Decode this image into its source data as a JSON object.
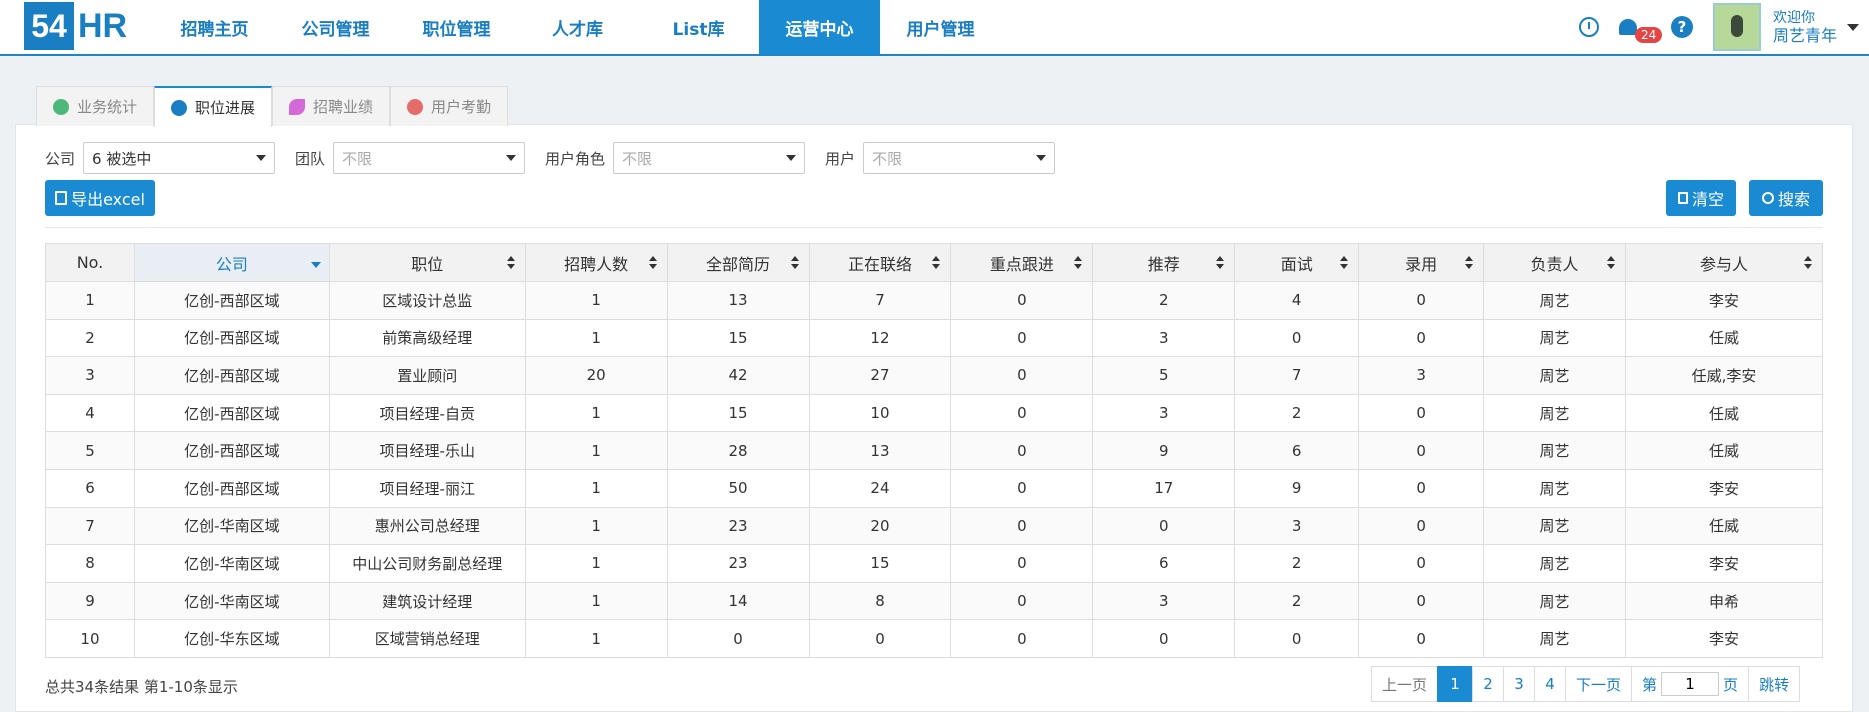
{
  "header": {
    "logo_number": "54",
    "logo_text": "HR",
    "nav": [
      {
        "label": "招聘主页"
      },
      {
        "label": "公司管理"
      },
      {
        "label": "职位管理"
      },
      {
        "label": "人才库"
      },
      {
        "label": "List库"
      },
      {
        "label": "运营中心",
        "active": true
      },
      {
        "label": "用户管理"
      }
    ],
    "notification_count": "24",
    "welcome": "欢迎你",
    "user_name": "周艺青年"
  },
  "tabs": [
    {
      "label": "业务统计",
      "icon": "user-icon"
    },
    {
      "label": "职位进展",
      "icon": "users-icon",
      "active": true
    },
    {
      "label": "招聘业绩",
      "icon": "leaf-icon"
    },
    {
      "label": "用户考勤",
      "icon": "attendance-icon"
    }
  ],
  "filters": {
    "company_label": "公司",
    "company_value": "6 被选中",
    "team_label": "团队",
    "team_placeholder": "不限",
    "role_label": "用户角色",
    "role_placeholder": "不限",
    "user_label": "用户",
    "user_placeholder": "不限"
  },
  "buttons": {
    "export": "导出excel",
    "clear": "清空",
    "search": "搜索"
  },
  "table": {
    "columns": [
      "No.",
      "公司",
      "职位",
      "招聘人数",
      "全部简历",
      "正在联络",
      "重点跟进",
      "推荐",
      "面试",
      "录用",
      "负责人",
      "参与人"
    ],
    "rows": [
      [
        "1",
        "亿创-西部区域",
        "区域设计总监",
        "1",
        "13",
        "7",
        "0",
        "2",
        "4",
        "0",
        "周艺",
        "李安"
      ],
      [
        "2",
        "亿创-西部区域",
        "前策高级经理",
        "1",
        "15",
        "12",
        "0",
        "3",
        "0",
        "0",
        "周艺",
        "任威"
      ],
      [
        "3",
        "亿创-西部区域",
        "置业顾问",
        "20",
        "42",
        "27",
        "0",
        "5",
        "7",
        "3",
        "周艺",
        "任威,李安"
      ],
      [
        "4",
        "亿创-西部区域",
        "项目经理-自贡",
        "1",
        "15",
        "10",
        "0",
        "3",
        "2",
        "0",
        "周艺",
        "任威"
      ],
      [
        "5",
        "亿创-西部区域",
        "项目经理-乐山",
        "1",
        "28",
        "13",
        "0",
        "9",
        "6",
        "0",
        "周艺",
        "任威"
      ],
      [
        "6",
        "亿创-西部区域",
        "项目经理-丽江",
        "1",
        "50",
        "24",
        "0",
        "17",
        "9",
        "0",
        "周艺",
        "李安"
      ],
      [
        "7",
        "亿创-华南区域",
        "惠州公司总经理",
        "1",
        "23",
        "20",
        "0",
        "0",
        "3",
        "0",
        "周艺",
        "任威"
      ],
      [
        "8",
        "亿创-华南区域",
        "中山公司财务副总经理",
        "1",
        "23",
        "15",
        "0",
        "6",
        "2",
        "0",
        "周艺",
        "李安"
      ],
      [
        "9",
        "亿创-华南区域",
        "建筑设计经理",
        "1",
        "14",
        "8",
        "0",
        "3",
        "2",
        "0",
        "周艺",
        "申希"
      ],
      [
        "10",
        "亿创-华东区域",
        "区域营销总经理",
        "1",
        "0",
        "0",
        "0",
        "0",
        "0",
        "0",
        "周艺",
        "李安"
      ]
    ]
  },
  "footer": {
    "summary": "总共34条结果  第1-10条显示",
    "prev": "上一页",
    "pages": [
      "1",
      "2",
      "3",
      "4"
    ],
    "next": "下一页",
    "goto_prefix": "第",
    "goto_value": "1",
    "goto_suffix": "页",
    "jump": "跳转"
  }
}
